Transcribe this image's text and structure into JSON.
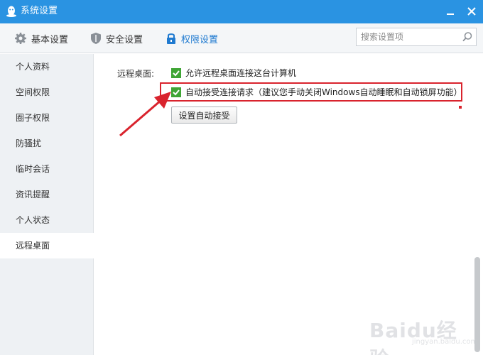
{
  "window": {
    "title": "系统设置"
  },
  "toolbar": {
    "tabs": [
      {
        "label": "基本设置",
        "icon": "gear-icon"
      },
      {
        "label": "安全设置",
        "icon": "shield-icon"
      },
      {
        "label": "权限设置",
        "icon": "lock-icon",
        "active": true
      }
    ],
    "search_placeholder": "搜索设置项"
  },
  "sidebar": {
    "items": [
      {
        "label": "个人资料"
      },
      {
        "label": "空间权限"
      },
      {
        "label": "圈子权限"
      },
      {
        "label": "防骚扰"
      },
      {
        "label": "临时会话"
      },
      {
        "label": "资讯提醒"
      },
      {
        "label": "个人状态"
      },
      {
        "label": "远程桌面",
        "active": true
      }
    ]
  },
  "content": {
    "section_label": "远程桌面:",
    "allow_remote": {
      "label": "允许远程桌面连接这台计算机",
      "checked": true
    },
    "auto_accept": {
      "label": "自动接受连接请求（建议您手动关闭Windows自动睡眠和自动锁屏功能）",
      "checked": true
    },
    "set_auto_accept_button": "设置自动接受"
  },
  "colors": {
    "titlebar": "#2a93e2",
    "accent": "#1f7ad0",
    "highlight": "#d9232d",
    "check": "#3fa535"
  },
  "watermark": {
    "text": "Baidu经验",
    "sub": "jingyan.baidu.com"
  }
}
